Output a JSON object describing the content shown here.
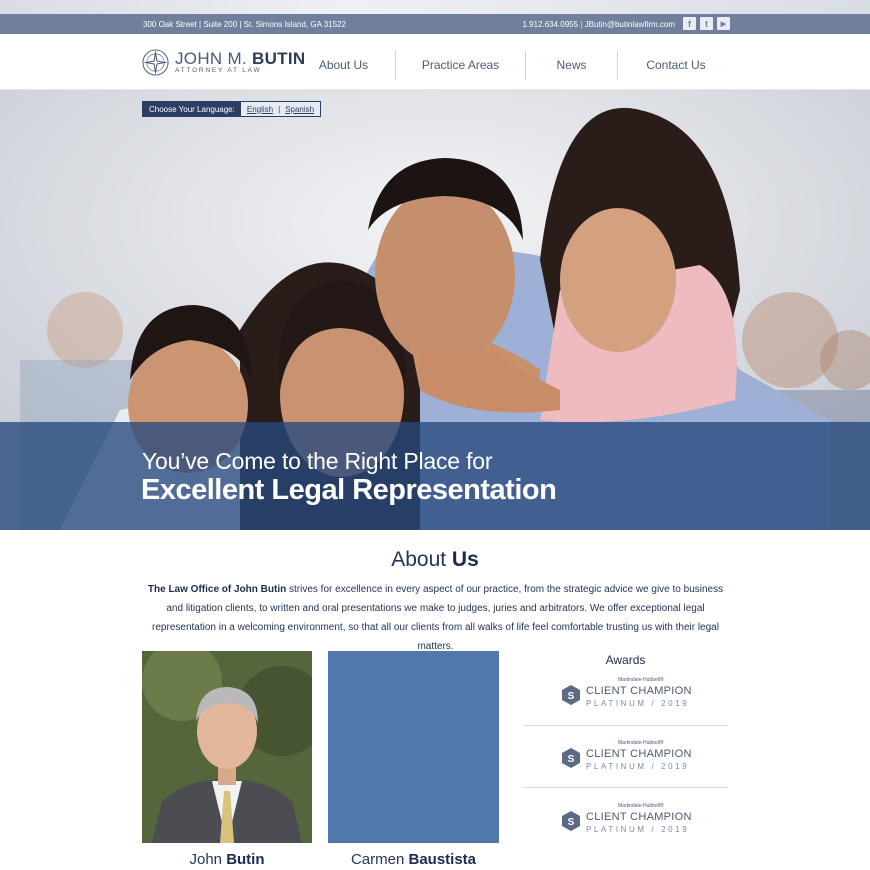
{
  "header": {
    "address": "300 Oak Street  |  Suite 200  |  St. Simons Island, GA 31522",
    "phone": "1.912.634.0955",
    "email": "JButin@butinlawfirm.com",
    "social": [
      {
        "icon": "facebook-icon",
        "glyph": "f"
      },
      {
        "icon": "twitter-icon",
        "glyph": "t"
      },
      {
        "icon": "youtube-icon",
        "glyph": "▶"
      }
    ]
  },
  "logo": {
    "first": "JOHN M. ",
    "last": "BUTIN",
    "tagline": "ATTORNEY AT LAW"
  },
  "nav": {
    "items": [
      "About Us",
      "Practice Areas",
      "News",
      "Contact Us"
    ]
  },
  "language": {
    "label": "Choose Your Language:",
    "english": "English",
    "separator": "|",
    "spanish": "Spanish"
  },
  "hero": {
    "line1": "You’ve Come to the Right Place for",
    "line2": "Excellent Legal Representation"
  },
  "about": {
    "title_light": "About ",
    "title_bold": "Us",
    "lead_bold": "The Law Office of John Butin",
    "body": " strives for excellence in every aspect of our practice, from the strategic advice we give to business and litigation clients, to written and oral presentations we make to judges, juries and arbitrators. We offer exceptional legal representation in a welcoming environment, so that all our clients from all walks of life feel comfortable trusting us with their legal matters."
  },
  "team": [
    {
      "first": "John ",
      "last": "Butin"
    },
    {
      "first": "Carmen ",
      "last": "Baustista"
    }
  ],
  "awards": {
    "title": "Awards",
    "items": [
      {
        "small": "Martindale-Hubbell®",
        "big": "CLIENT CHAMPION",
        "level": "PLATINUM / 2019"
      },
      {
        "small": "Martindale-Hubbell®",
        "big": "CLIENT CHAMPION",
        "level": "PLATINUM / 2019"
      },
      {
        "small": "Martindale-Hubbell®",
        "big": "CLIENT CHAMPION",
        "level": "PLATINUM / 2019"
      }
    ]
  },
  "colors": {
    "navy": "#1d2b4e",
    "infobar": "#6f7f9c",
    "hero_band": "#26497e",
    "blue_box": "#5078ad"
  }
}
